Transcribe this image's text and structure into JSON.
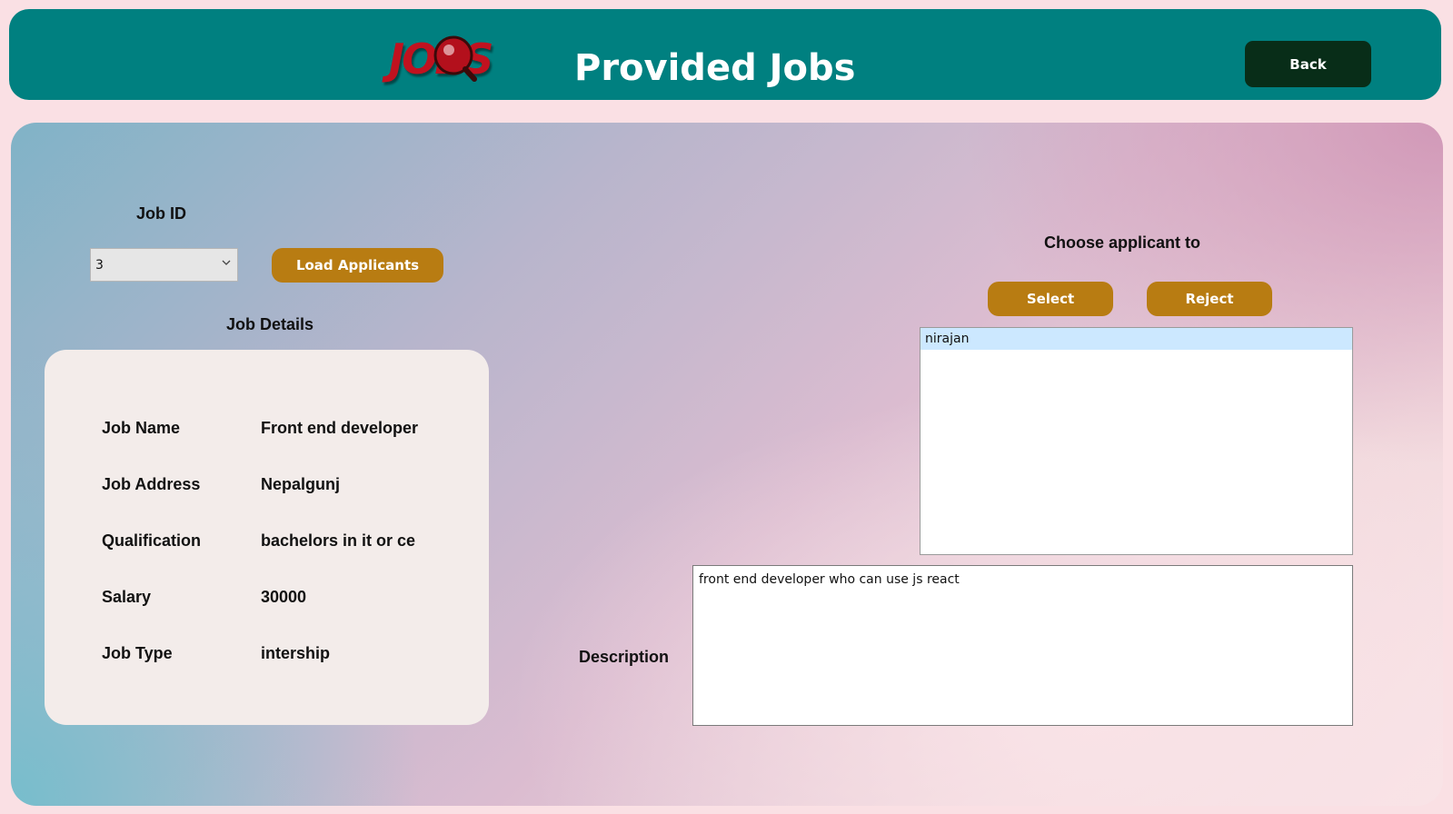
{
  "header": {
    "logo_text": "JOBS",
    "title": "Provided Jobs",
    "back_label": "Back"
  },
  "job_id": {
    "label": "Job ID",
    "selected_value": "3",
    "load_button_label": "Load Applicants"
  },
  "job_details": {
    "heading": "Job Details",
    "rows": [
      {
        "label": "Job Name",
        "value": "Front end developer"
      },
      {
        "label": "Job Address",
        "value": "Nepalgunj"
      },
      {
        "label": "Qualification",
        "value": "bachelors in it or ce"
      },
      {
        "label": "Salary",
        "value": "30000"
      },
      {
        "label": "Job Type",
        "value": "intership"
      }
    ]
  },
  "applicants": {
    "heading": "Choose applicant to",
    "select_label": "Select",
    "reject_label": "Reject",
    "items": [
      "nirajan"
    ],
    "selected_index": 0
  },
  "description": {
    "label": "Description",
    "value": "front end developer who can use js react"
  },
  "colors": {
    "header_bg": "#008080",
    "back_button_bg": "#082d18",
    "gold_button_bg": "#b87c12",
    "page_bg": "#fae0e4",
    "list_selection": "#cce8ff"
  },
  "icons": {
    "logo": "jobs-magnifier-logo",
    "dropdown": "chevron-down-icon"
  }
}
